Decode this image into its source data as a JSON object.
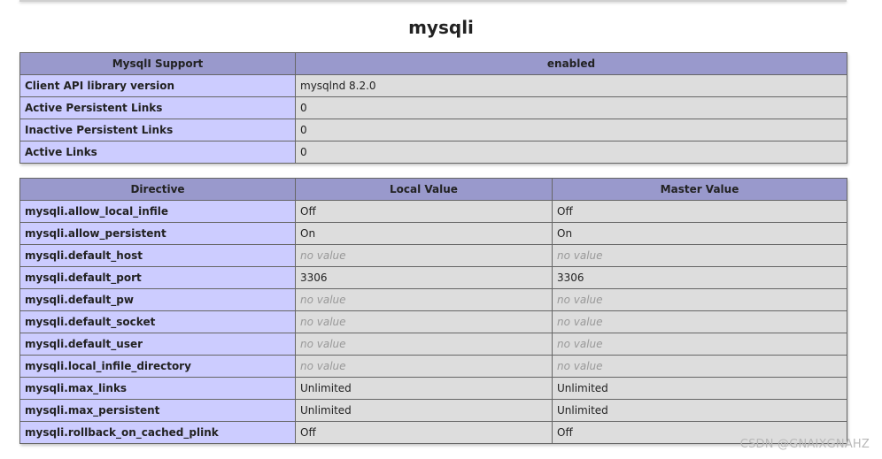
{
  "module": {
    "title": "mysqli"
  },
  "support_table": {
    "header": [
      "MysqlI Support",
      "enabled"
    ],
    "rows": [
      {
        "label": "Client API library version",
        "value": "mysqlnd 8.2.0"
      },
      {
        "label": "Active Persistent Links",
        "value": "0"
      },
      {
        "label": "Inactive Persistent Links",
        "value": "0"
      },
      {
        "label": "Active Links",
        "value": "0"
      }
    ]
  },
  "directive_table": {
    "headers": [
      "Directive",
      "Local Value",
      "Master Value"
    ],
    "rows": [
      {
        "directive": "mysqli.allow_local_infile",
        "local": "Off",
        "master": "Off",
        "no_value": false
      },
      {
        "directive": "mysqli.allow_persistent",
        "local": "On",
        "master": "On",
        "no_value": false
      },
      {
        "directive": "mysqli.default_host",
        "local": "no value",
        "master": "no value",
        "no_value": true
      },
      {
        "directive": "mysqli.default_port",
        "local": "3306",
        "master": "3306",
        "no_value": false
      },
      {
        "directive": "mysqli.default_pw",
        "local": "no value",
        "master": "no value",
        "no_value": true
      },
      {
        "directive": "mysqli.default_socket",
        "local": "no value",
        "master": "no value",
        "no_value": true
      },
      {
        "directive": "mysqli.default_user",
        "local": "no value",
        "master": "no value",
        "no_value": true
      },
      {
        "directive": "mysqli.local_infile_directory",
        "local": "no value",
        "master": "no value",
        "no_value": true
      },
      {
        "directive": "mysqli.max_links",
        "local": "Unlimited",
        "master": "Unlimited",
        "no_value": false
      },
      {
        "directive": "mysqli.max_persistent",
        "local": "Unlimited",
        "master": "Unlimited",
        "no_value": false
      },
      {
        "directive": "mysqli.rollback_on_cached_plink",
        "local": "Off",
        "master": "Off",
        "no_value": false
      }
    ]
  },
  "watermark": {
    "text": "CSDN @GNAIXGNAHZ"
  },
  "colors": {
    "header_bg": "#9999cc",
    "key_bg": "#ccccff",
    "value_bg": "#dddddd",
    "no_value_text": "#999999",
    "border": "#666666"
  }
}
